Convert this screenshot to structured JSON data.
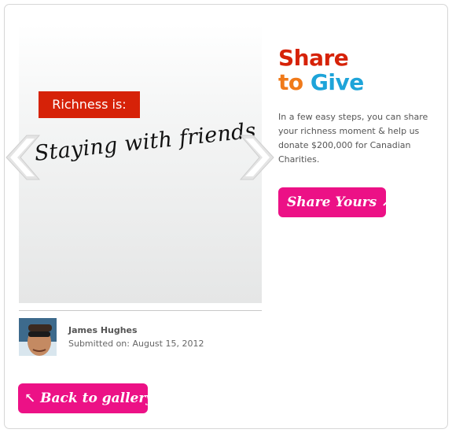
{
  "slide": {
    "tag_label": "Richness is:",
    "moment_text": "Staying with friends"
  },
  "author": {
    "name": "James Hughes",
    "submitted": "Submitted on: August 15, 2012"
  },
  "promo": {
    "title_line1": "Share",
    "title_to": "to",
    "title_give": "Give",
    "description": "In a few easy steps, you can share your richness moment & help us donate $200,000 for Canadian Charities.",
    "share_label": "Share Yours",
    "share_arrow": "↗"
  },
  "nav": {
    "back_label": "Back to gallery",
    "back_arrow": "↖"
  },
  "colors": {
    "red": "#d62208",
    "orange": "#f07a1a",
    "blue": "#1ea4d9",
    "pink": "#ec1186"
  },
  "icons": {
    "prev": "chevron-left-icon",
    "next": "chevron-right-icon"
  }
}
